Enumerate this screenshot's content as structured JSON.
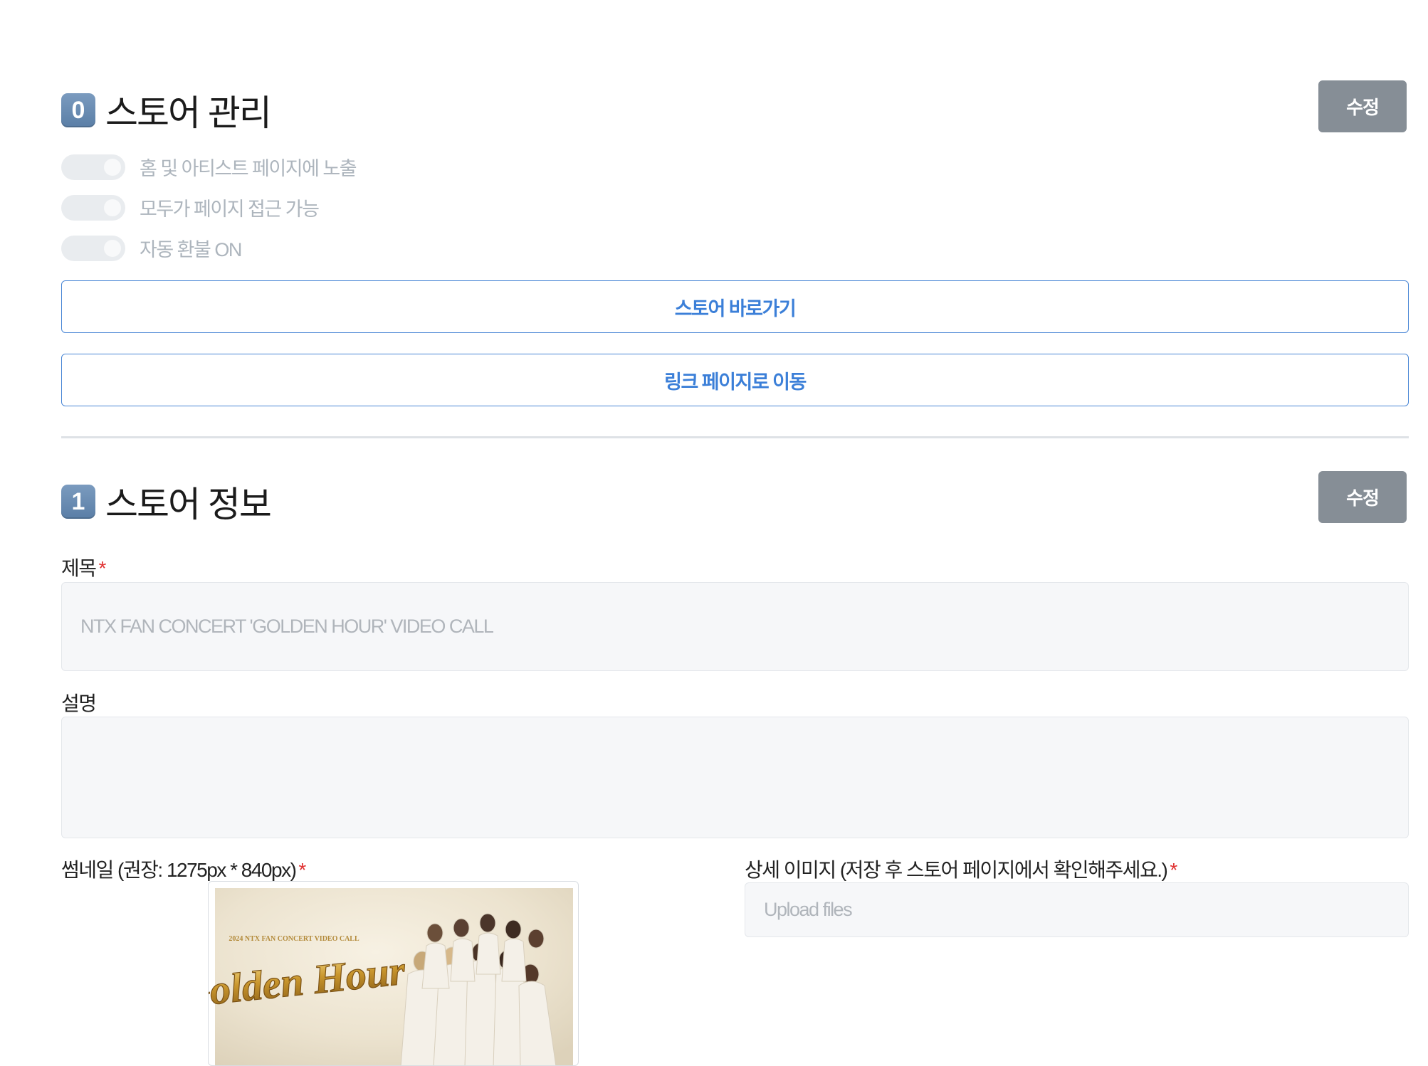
{
  "store_manage": {
    "number": "0",
    "title": "스토어 관리",
    "edit_label": "수정",
    "toggles": [
      {
        "label": "홈 및 아티스트 페이지에 노출",
        "on": false
      },
      {
        "label": "모두가 페이지 접근 가능",
        "on": false
      },
      {
        "label": "자동 환불 ON",
        "on": false
      }
    ],
    "go_store_label": "스토어 바로가기",
    "link_page_label": "링크 페이지로 이동"
  },
  "store_info": {
    "number": "1",
    "title": "스토어 정보",
    "edit_label": "수정",
    "title_field": {
      "label": "제목",
      "required_mark": "*",
      "value": "NTX FAN CONCERT 'GOLDEN HOUR' VIDEO CALL"
    },
    "desc_field": {
      "label": "설명",
      "value": ""
    },
    "thumbnail_field": {
      "label": "썸네일 (권장: 1275px * 840px)",
      "required_mark": "*"
    },
    "detail_field": {
      "label": "상세 이미지 (저장 후 스토어 페이지에서 확인해주세요.)",
      "required_mark": "*",
      "placeholder": "Upload files"
    },
    "thumbnail_text": {
      "top": "2024 NTX FAN CONCERT VIDEO CALL",
      "logo": "Golden Hour"
    }
  }
}
